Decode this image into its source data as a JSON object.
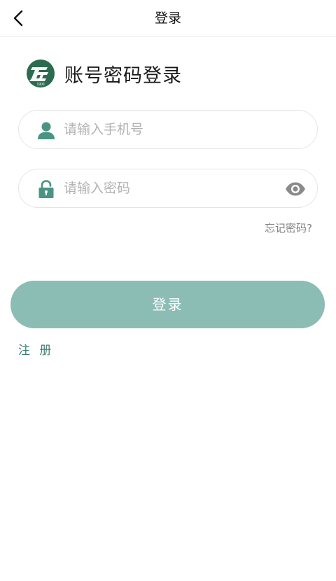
{
  "nav": {
    "title": "登录"
  },
  "brand": {
    "logo_year": "1900",
    "title": "账号密码登录"
  },
  "form": {
    "phone_placeholder": "请输入手机号",
    "password_placeholder": "请输入密码",
    "forgot_label": "忘记密码?",
    "login_label": "登录",
    "register_label": "注 册"
  },
  "colors": {
    "accent": "#8bbdb5",
    "brand_green": "#2c6b4f",
    "icon_green": "#4a9483",
    "register_text": "#3f7f72"
  },
  "icons": {
    "back": "chevron-left-icon",
    "user": "user-icon",
    "lock": "lock-icon",
    "eye": "eye-icon"
  }
}
